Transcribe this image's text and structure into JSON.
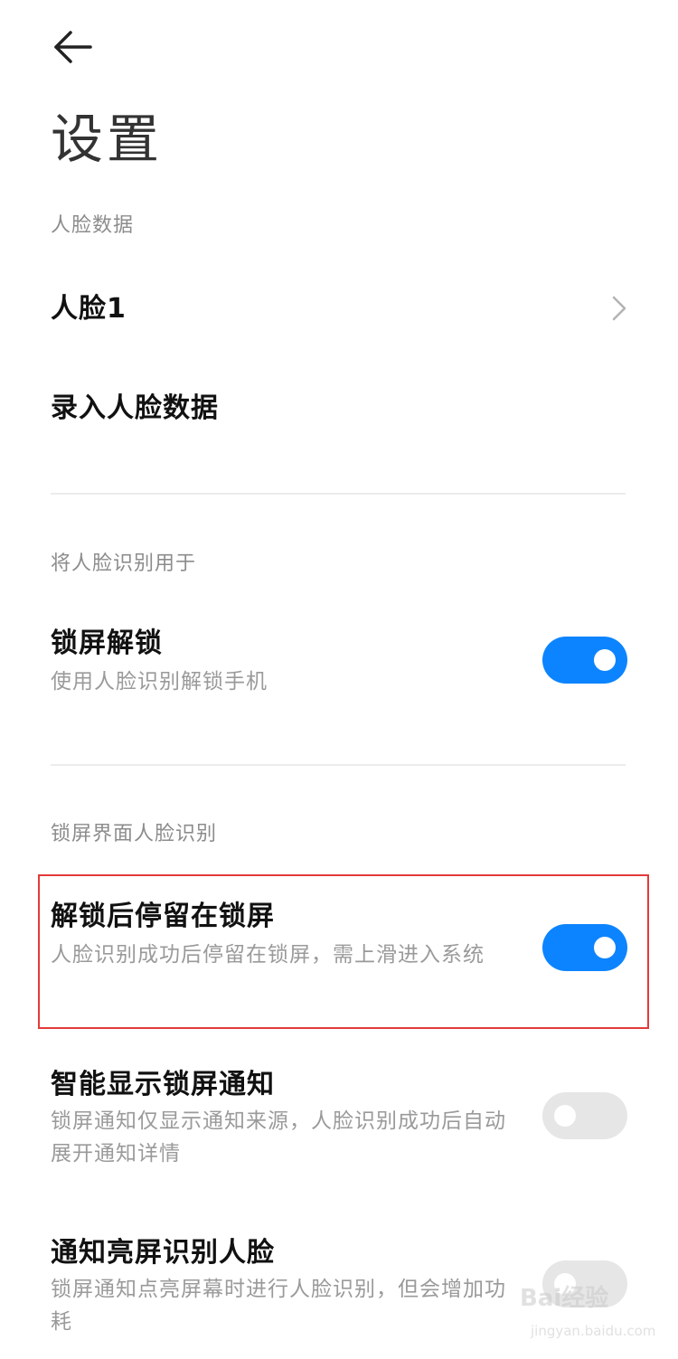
{
  "header": {
    "title": "设置"
  },
  "sections": {
    "face_data": {
      "header": "人脸数据",
      "face_item": "人脸1",
      "enroll_item": "录入人脸数据"
    },
    "use_for": {
      "header": "将人脸识别用于",
      "lock_unlock": {
        "title": "锁屏解锁",
        "subtitle": "使用人脸识别解锁手机",
        "enabled": true
      }
    },
    "lockscreen": {
      "header": "锁屏界面人脸识别",
      "stay_on_lockscreen": {
        "title": "解锁后停留在锁屏",
        "subtitle": "人脸识别成功后停留在锁屏，需上滑进入系统",
        "enabled": true
      },
      "smart_notifications": {
        "title": "智能显示锁屏通知",
        "subtitle": "锁屏通知仅显示通知来源，人脸识别成功后自动展开通知详情",
        "enabled": false
      },
      "notification_wake": {
        "title": "通知亮屏识别人脸",
        "subtitle": "锁屏通知点亮屏幕时进行人脸识别，但会增加功耗",
        "enabled": false
      }
    }
  },
  "watermark": {
    "brand": "Bai经验",
    "url": "jingyan.baidu.com"
  },
  "colors": {
    "accent": "#0d84ff",
    "highlight": "#e23a3a",
    "toggle_off": "#e6e6e6"
  },
  "icons": {
    "back": "arrow-left-icon",
    "chevron": "chevron-right-icon"
  }
}
